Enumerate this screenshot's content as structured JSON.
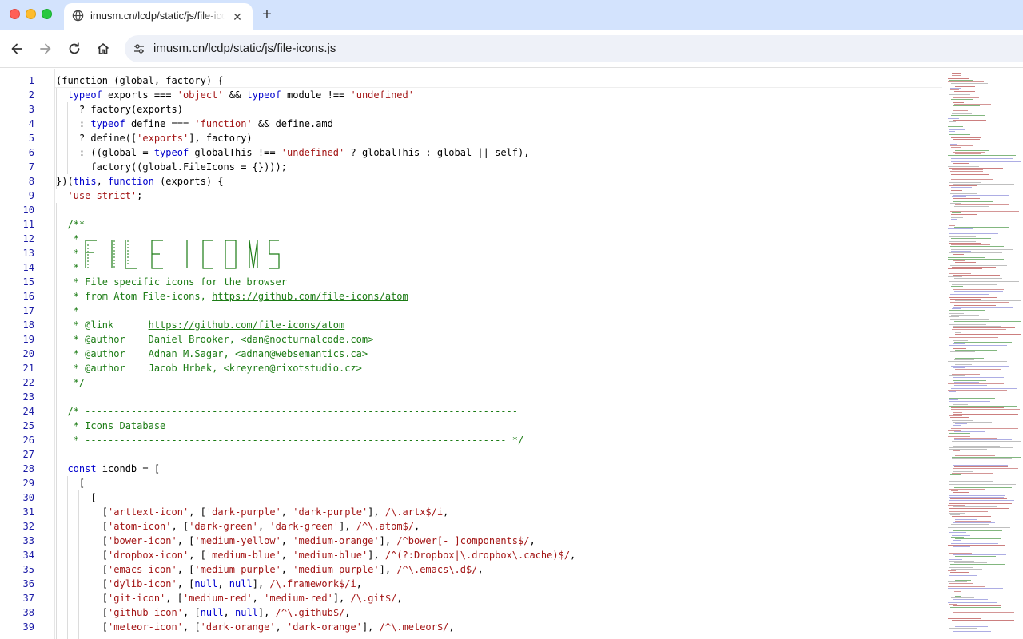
{
  "browser": {
    "tab": {
      "title": "imusm.cn/lcdp/static/js/file-icons.js",
      "close_icon": "close-icon",
      "favicon": "globe-icon"
    },
    "new_tab_icon": "plus-icon",
    "nav": {
      "back_icon": "arrow-left-icon",
      "forward_icon": "arrow-right-icon",
      "reload_icon": "reload-icon",
      "home_icon": "home-icon"
    },
    "address_bar": {
      "url": "imusm.cn/lcdp/static/js/file-icons.js",
      "site_info_icon": "tune-icon"
    }
  },
  "colors": {
    "tabstrip": "#d3e3fd",
    "keyword": "#0000cd",
    "string": "#a31515",
    "comment": "#1c7c15",
    "line_number": "#1a1aa6"
  },
  "code": {
    "lines": [
      {
        "n": "1",
        "t": [
          [
            "p",
            "(function (global, factory) {"
          ]
        ]
      },
      {
        "n": "2",
        "t": [
          [
            "p",
            "  "
          ],
          [
            "k",
            "typeof"
          ],
          [
            "p",
            " exports === "
          ],
          [
            "s",
            "'object'"
          ],
          [
            "p",
            " && "
          ],
          [
            "k",
            "typeof"
          ],
          [
            "p",
            " module !== "
          ],
          [
            "s",
            "'undefined'"
          ]
        ]
      },
      {
        "n": "3",
        "t": [
          [
            "p",
            "    ? factory(exports)"
          ]
        ]
      },
      {
        "n": "4",
        "t": [
          [
            "p",
            "    : "
          ],
          [
            "k",
            "typeof"
          ],
          [
            "p",
            " define === "
          ],
          [
            "s",
            "'function'"
          ],
          [
            "p",
            " && define.amd"
          ]
        ]
      },
      {
        "n": "5",
        "t": [
          [
            "p",
            "    ? define(["
          ],
          [
            "s",
            "'exports'"
          ],
          [
            "p",
            "], factory)"
          ]
        ]
      },
      {
        "n": "6",
        "t": [
          [
            "p",
            "    : ((global = "
          ],
          [
            "k",
            "typeof"
          ],
          [
            "p",
            " globalThis !== "
          ],
          [
            "s",
            "'undefined'"
          ],
          [
            "p",
            " ? globalThis : global || self),"
          ]
        ]
      },
      {
        "n": "7",
        "t": [
          [
            "p",
            "      factory((global.FileIcons = {})));"
          ]
        ]
      },
      {
        "n": "8",
        "t": [
          [
            "p",
            "})("
          ],
          [
            "k",
            "this"
          ],
          [
            "p",
            ", "
          ],
          [
            "k",
            "function"
          ],
          [
            "p",
            " (exports) {"
          ]
        ]
      },
      {
        "n": "9",
        "t": [
          [
            "p",
            "  "
          ],
          [
            "s",
            "'use strict'"
          ],
          [
            "p",
            ";"
          ]
        ]
      },
      {
        "n": "10",
        "t": [
          [
            "p",
            ""
          ]
        ]
      },
      {
        "n": "11",
        "t": [
          [
            "c",
            "  /**"
          ]
        ]
      },
      {
        "n": "12",
        "t": [
          [
            "c",
            "   *"
          ]
        ]
      },
      {
        "n": "13",
        "t": [
          [
            "c",
            "   *"
          ]
        ]
      },
      {
        "n": "14",
        "t": [
          [
            "c",
            "   *"
          ]
        ]
      },
      {
        "n": "15",
        "t": [
          [
            "c",
            "   * File specific icons for the browser"
          ]
        ]
      },
      {
        "n": "16",
        "t": [
          [
            "c",
            "   * from Atom File-icons, "
          ],
          [
            "l",
            "https://github.com/file-icons/atom"
          ]
        ]
      },
      {
        "n": "17",
        "t": [
          [
            "c",
            "   *"
          ]
        ]
      },
      {
        "n": "18",
        "t": [
          [
            "c",
            "   * @link      "
          ],
          [
            "l",
            "https://github.com/file-icons/atom"
          ]
        ]
      },
      {
        "n": "19",
        "t": [
          [
            "c",
            "   * @author    Daniel Brooker, <dan@nocturnalcode.com>"
          ]
        ]
      },
      {
        "n": "20",
        "t": [
          [
            "c",
            "   * @author    Adnan M.Sagar, <adnan@websemantics.ca>"
          ]
        ]
      },
      {
        "n": "21",
        "t": [
          [
            "c",
            "   * @author    Jacob Hrbek, <kreyren@rixotstudio.cz>"
          ]
        ]
      },
      {
        "n": "22",
        "t": [
          [
            "c",
            "   */"
          ]
        ]
      },
      {
        "n": "23",
        "t": [
          [
            "p",
            ""
          ]
        ]
      },
      {
        "n": "24",
        "t": [
          [
            "c",
            "  /* ---------------------------------------------------------------------------"
          ]
        ]
      },
      {
        "n": "25",
        "t": [
          [
            "c",
            "   * Icons Database"
          ]
        ]
      },
      {
        "n": "26",
        "t": [
          [
            "c",
            "   * ------------------------------------------------------------------------- */"
          ]
        ]
      },
      {
        "n": "27",
        "t": [
          [
            "p",
            ""
          ]
        ]
      },
      {
        "n": "28",
        "t": [
          [
            "p",
            "  "
          ],
          [
            "k",
            "const"
          ],
          [
            "p",
            " icondb = ["
          ]
        ]
      },
      {
        "n": "29",
        "t": [
          [
            "p",
            "    ["
          ]
        ]
      },
      {
        "n": "30",
        "t": [
          [
            "p",
            "      ["
          ]
        ]
      },
      {
        "n": "31",
        "t": [
          [
            "p",
            "        ["
          ],
          [
            "s",
            "'arttext-icon'"
          ],
          [
            "p",
            ", ["
          ],
          [
            "s",
            "'dark-purple'"
          ],
          [
            "p",
            ", "
          ],
          [
            "s",
            "'dark-purple'"
          ],
          [
            "p",
            "], "
          ],
          [
            "r",
            "/\\.artx$/i"
          ],
          [
            "p",
            ","
          ]
        ]
      },
      {
        "n": "32",
        "t": [
          [
            "p",
            "        ["
          ],
          [
            "s",
            "'atom-icon'"
          ],
          [
            "p",
            ", ["
          ],
          [
            "s",
            "'dark-green'"
          ],
          [
            "p",
            ", "
          ],
          [
            "s",
            "'dark-green'"
          ],
          [
            "p",
            "], "
          ],
          [
            "r",
            "/^\\.atom$/"
          ],
          [
            "p",
            ","
          ]
        ]
      },
      {
        "n": "33",
        "t": [
          [
            "p",
            "        ["
          ],
          [
            "s",
            "'bower-icon'"
          ],
          [
            "p",
            ", ["
          ],
          [
            "s",
            "'medium-yellow'"
          ],
          [
            "p",
            ", "
          ],
          [
            "s",
            "'medium-orange'"
          ],
          [
            "p",
            "], "
          ],
          [
            "r",
            "/^bower[-_]components$/"
          ],
          [
            "p",
            ","
          ]
        ]
      },
      {
        "n": "34",
        "t": [
          [
            "p",
            "        ["
          ],
          [
            "s",
            "'dropbox-icon'"
          ],
          [
            "p",
            ", ["
          ],
          [
            "s",
            "'medium-blue'"
          ],
          [
            "p",
            ", "
          ],
          [
            "s",
            "'medium-blue'"
          ],
          [
            "p",
            "], "
          ],
          [
            "r",
            "/^(?:Dropbox|\\.dropbox\\.cache)$/"
          ],
          [
            "p",
            ","
          ]
        ]
      },
      {
        "n": "35",
        "t": [
          [
            "p",
            "        ["
          ],
          [
            "s",
            "'emacs-icon'"
          ],
          [
            "p",
            ", ["
          ],
          [
            "s",
            "'medium-purple'"
          ],
          [
            "p",
            ", "
          ],
          [
            "s",
            "'medium-purple'"
          ],
          [
            "p",
            "], "
          ],
          [
            "r",
            "/^\\.emacs\\.d$/"
          ],
          [
            "p",
            ","
          ]
        ]
      },
      {
        "n": "36",
        "t": [
          [
            "p",
            "        ["
          ],
          [
            "s",
            "'dylib-icon'"
          ],
          [
            "p",
            ", ["
          ],
          [
            "k",
            "null"
          ],
          [
            "p",
            ", "
          ],
          [
            "k",
            "null"
          ],
          [
            "p",
            "], "
          ],
          [
            "r",
            "/\\.framework$/i"
          ],
          [
            "p",
            ","
          ]
        ]
      },
      {
        "n": "37",
        "t": [
          [
            "p",
            "        ["
          ],
          [
            "s",
            "'git-icon'"
          ],
          [
            "p",
            ", ["
          ],
          [
            "s",
            "'medium-red'"
          ],
          [
            "p",
            ", "
          ],
          [
            "s",
            "'medium-red'"
          ],
          [
            "p",
            "], "
          ],
          [
            "r",
            "/\\.git$/"
          ],
          [
            "p",
            ","
          ]
        ]
      },
      {
        "n": "38",
        "t": [
          [
            "p",
            "        ["
          ],
          [
            "s",
            "'github-icon'"
          ],
          [
            "p",
            ", ["
          ],
          [
            "k",
            "null"
          ],
          [
            "p",
            ", "
          ],
          [
            "k",
            "null"
          ],
          [
            "p",
            "], "
          ],
          [
            "r",
            "/^\\.github$/"
          ],
          [
            "p",
            ","
          ]
        ]
      },
      {
        "n": "39",
        "t": [
          [
            "p",
            "        ["
          ],
          [
            "s",
            "'meteor-icon'"
          ],
          [
            "p",
            ", ["
          ],
          [
            "s",
            "'dark-orange'"
          ],
          [
            "p",
            ", "
          ],
          [
            "s",
            "'dark-orange'"
          ],
          [
            "p",
            "], "
          ],
          [
            "r",
            "/^\\.meteor$/"
          ],
          [
            "p",
            ","
          ]
        ]
      }
    ],
    "banner_art": "FILE ICONS"
  }
}
